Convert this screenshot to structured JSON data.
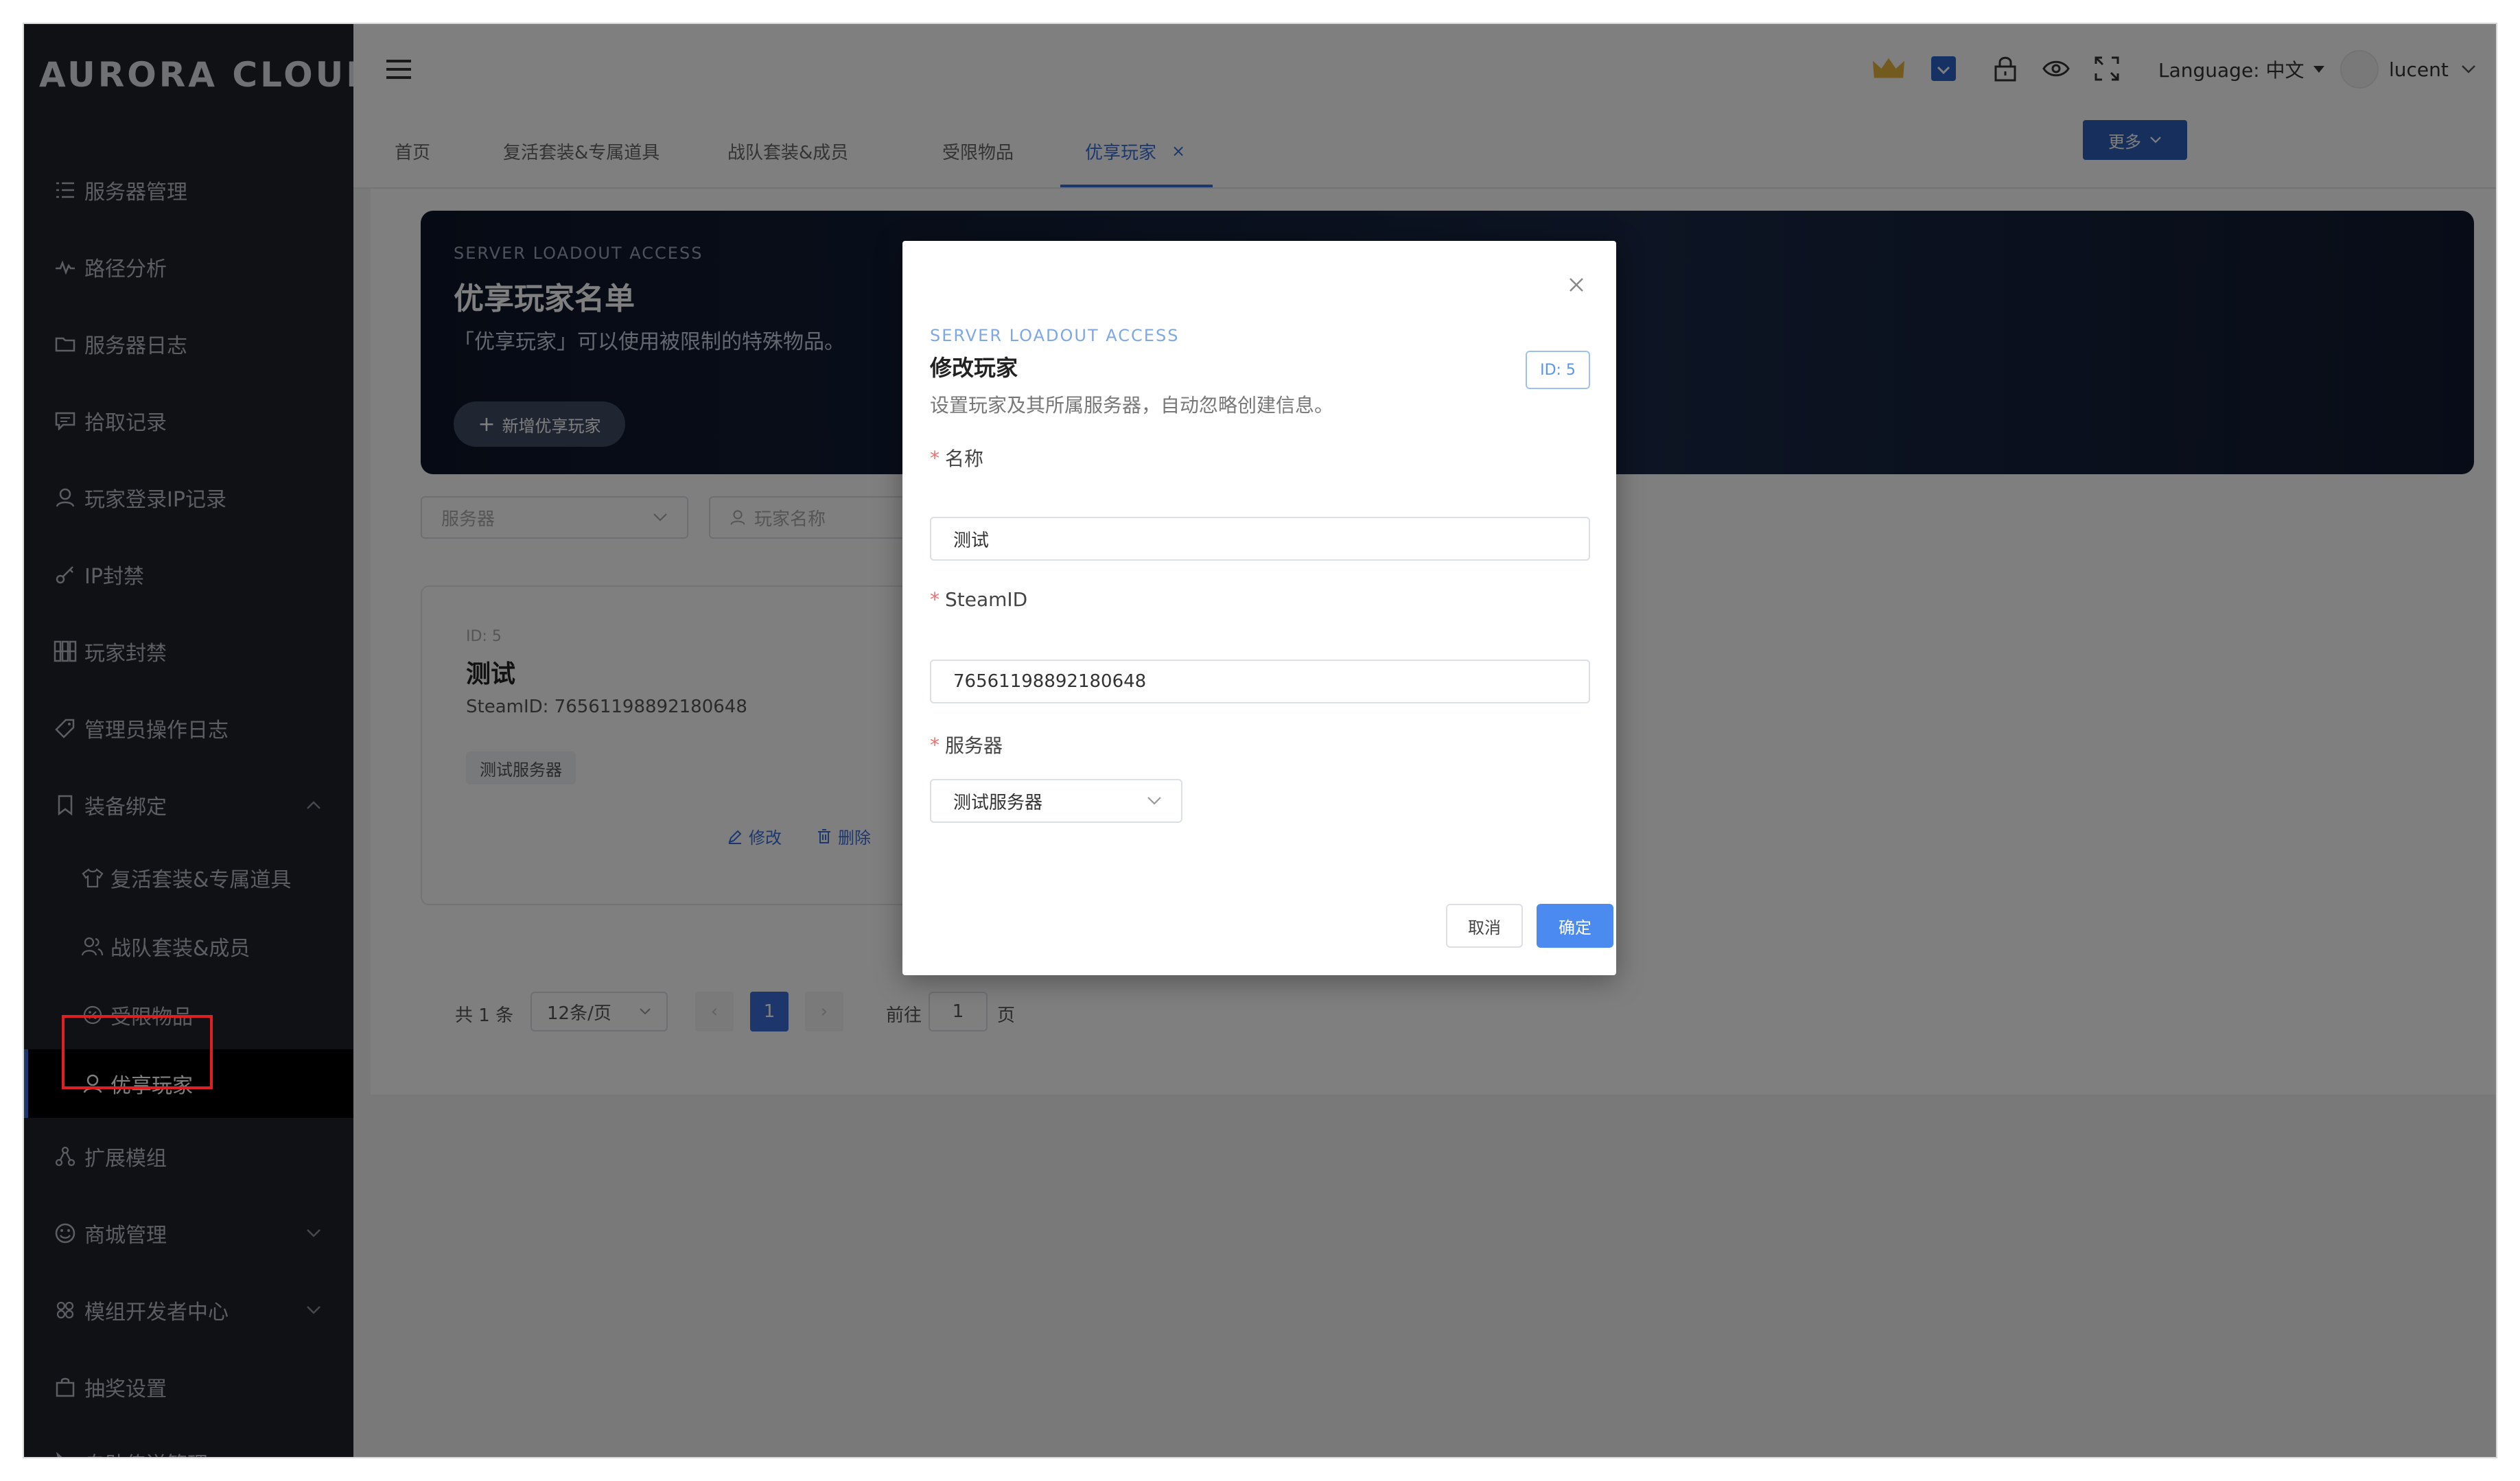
{
  "app": {
    "logo": "AURORA CLOUD"
  },
  "sidebar": {
    "items": [
      {
        "label": "服务器管理",
        "icon": "list-icon"
      },
      {
        "label": "路径分析",
        "icon": "pulse-icon"
      },
      {
        "label": "服务器日志",
        "icon": "folder-icon"
      },
      {
        "label": "拾取记录",
        "icon": "message-icon"
      },
      {
        "label": "玩家登录IP记录",
        "icon": "user-icon"
      },
      {
        "label": "IP封禁",
        "icon": "key-icon"
      },
      {
        "label": "玩家封禁",
        "icon": "grid-icon"
      },
      {
        "label": "管理员操作日志",
        "icon": "tag-icon"
      },
      {
        "label": "装备绑定",
        "icon": "bookmark-icon",
        "expanded": true
      }
    ],
    "sub_items": [
      {
        "label": "复活套装&专属道具",
        "icon": "shirt-icon"
      },
      {
        "label": "战队套装&成员",
        "icon": "users-icon"
      },
      {
        "label": "受限物品",
        "icon": "percent-icon"
      },
      {
        "label": "优享玩家",
        "icon": "user-icon",
        "active": true
      }
    ],
    "items_after": [
      {
        "label": "扩展模组",
        "icon": "share-icon"
      },
      {
        "label": "商城管理",
        "icon": "smile-icon"
      },
      {
        "label": "模组开发者中心",
        "icon": "cluster-icon"
      },
      {
        "label": "抽奖设置",
        "icon": "bag-icon"
      },
      {
        "label": "自助传送管理",
        "icon": "pointer-icon"
      }
    ]
  },
  "header": {
    "language_label": "Language: 中文",
    "user": "lucent"
  },
  "tabs": [
    {
      "label": "首页"
    },
    {
      "label": "复活套装&专属道具"
    },
    {
      "label": "战队套装&成员"
    },
    {
      "label": "受限物品"
    },
    {
      "label": "优享玩家",
      "active": true
    }
  ],
  "more_button": "更多",
  "banner": {
    "kicker": "SERVER LOADOUT ACCESS",
    "title": "优享玩家名单",
    "desc": "「优享玩家」可以使用被限制的特殊物品。",
    "add_button": "新增优享玩家"
  },
  "filters": {
    "server_placeholder": "服务器",
    "name_placeholder": "玩家名称"
  },
  "card": {
    "id": "ID: 5",
    "name": "测试",
    "steam": "SteamID: 76561198892180648",
    "server": "测试服务器",
    "edit": "修改",
    "delete": "删除"
  },
  "pagination": {
    "total": "共 1 条",
    "page_size": "12条/页",
    "current": "1",
    "goto_prefix": "前往",
    "goto_value": "1",
    "goto_suffix": "页"
  },
  "modal": {
    "kicker": "SERVER LOADOUT ACCESS",
    "title": "修改玩家",
    "badge": "ID: 5",
    "subtitle": "设置玩家及其所属服务器，自动忽略创建信息。",
    "name_label": "名称",
    "name_value": "测试",
    "steam_label": "SteamID",
    "steam_value": "76561198892180648",
    "server_label": "服务器",
    "server_value": "测试服务器",
    "cancel": "取消",
    "ok": "确定"
  },
  "colors": {
    "sidebar_bg": "#1f2229",
    "accent": "#3a6fd8",
    "primary_button": "#4b8bf0",
    "highlight": "#e02020"
  }
}
